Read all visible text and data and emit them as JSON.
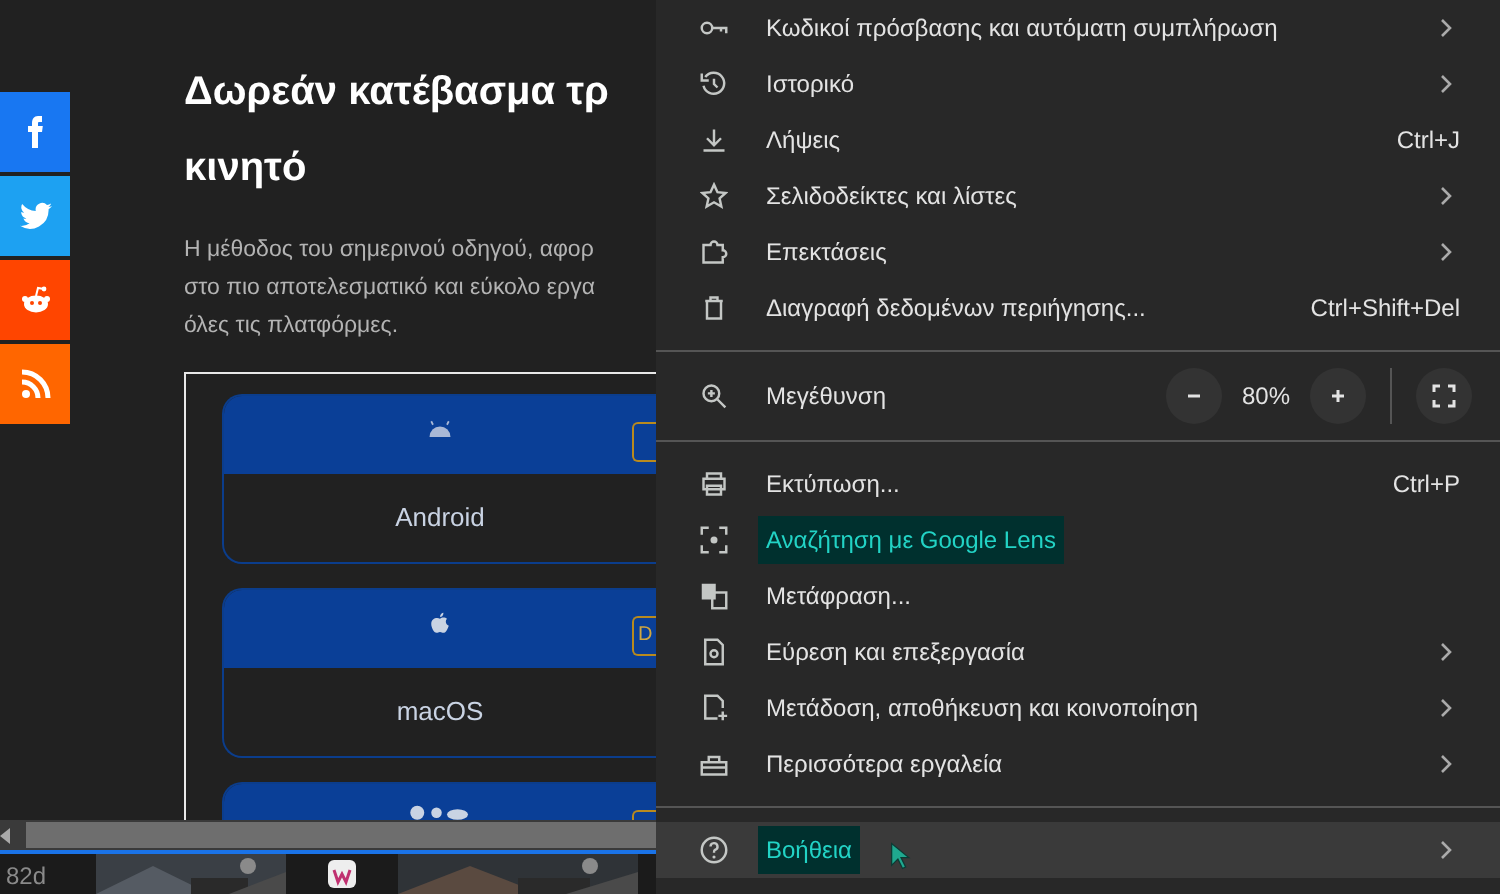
{
  "social_buttons": [
    {
      "kind": "facebook",
      "color": "#1877f2"
    },
    {
      "kind": "twitter",
      "color": "#1da1f2"
    },
    {
      "kind": "reddit",
      "color": "#ff4500"
    },
    {
      "kind": "rss",
      "color": "#ff6600"
    }
  ],
  "article": {
    "title_lines": [
      "Δωρεάν κατέβασμα τρ",
      "κινητό"
    ],
    "intro_lines": [
      "Η μέθοδος του σημερινού οδηγού, αφορ",
      "στο πιο αποτελεσματικό και εύκολο εργα",
      "όλες τις πλατφόρμες."
    ],
    "platforms": [
      {
        "kind": "android",
        "name": "Android"
      },
      {
        "kind": "apple",
        "name": "macOS",
        "button_text": "D"
      },
      {
        "kind": "multi"
      }
    ]
  },
  "bottom_strip": {
    "label": "82d"
  },
  "menu": {
    "sections": [
      {
        "items": [
          {
            "kind": "item",
            "label": "Κωδικοί πρόσβασης και αυτόματη συμπλήρωση",
            "submenu": true,
            "highlighted": false,
            "hovered": false
          },
          {
            "kind": "item",
            "label": "Ιστορικό",
            "submenu": true,
            "highlighted": false,
            "hovered": false
          },
          {
            "kind": "item",
            "label": "Λήψεις",
            "shortcut": "Ctrl+J",
            "submenu": false,
            "highlighted": false,
            "hovered": false
          },
          {
            "kind": "item",
            "label": "Σελιδοδείκτες και λίστες",
            "submenu": true,
            "highlighted": false,
            "hovered": false
          },
          {
            "kind": "item",
            "label": "Επεκτάσεις",
            "submenu": true,
            "highlighted": false,
            "hovered": false
          },
          {
            "kind": "item",
            "label": "Διαγραφή δεδομένων περιήγησης...",
            "shortcut": "Ctrl+Shift+Del",
            "submenu": false,
            "highlighted": false,
            "hovered": false
          }
        ]
      },
      {
        "items": [
          {
            "kind": "zoom",
            "label": "Μεγέθυνση",
            "value": "80%",
            "submenu": false,
            "highlighted": false,
            "hovered": false
          }
        ]
      },
      {
        "items": [
          {
            "kind": "item",
            "label": "Εκτύπωση...",
            "shortcut": "Ctrl+P",
            "submenu": false,
            "highlighted": false,
            "hovered": false
          },
          {
            "kind": "item",
            "label": "Αναζήτηση με Google Lens",
            "submenu": false,
            "highlighted": true,
            "hovered": false
          },
          {
            "kind": "item",
            "label": "Μετάφραση...",
            "submenu": false,
            "highlighted": false,
            "hovered": false
          },
          {
            "kind": "item",
            "label": "Εύρεση και επεξεργασία",
            "submenu": true,
            "highlighted": false,
            "hovered": false
          },
          {
            "kind": "item",
            "label": "Μετάδοση, αποθήκευση και κοινοποίηση",
            "submenu": true,
            "highlighted": false,
            "hovered": false
          },
          {
            "kind": "item",
            "label": "Περισσότερα εργαλεία",
            "submenu": true,
            "highlighted": false,
            "hovered": false
          }
        ]
      },
      {
        "items": [
          {
            "kind": "item",
            "label": "Βοήθεια",
            "submenu": true,
            "highlighted": true,
            "hovered": true
          }
        ]
      }
    ]
  }
}
